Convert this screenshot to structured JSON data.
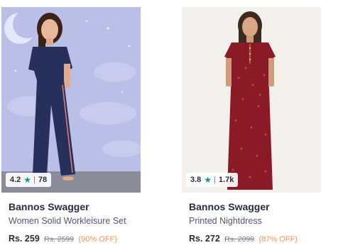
{
  "products": [
    {
      "brand": "Bannos Swagger",
      "name": "Women Solid Workleisure Set",
      "price": "Rs. 259",
      "mrp": "Rs. 2599",
      "discount": "(90% OFF)",
      "rating": "4.2",
      "rating_count": "78",
      "rating_sep": "|"
    },
    {
      "brand": "Bannos Swagger",
      "name": "Printed Nightdress",
      "price": "Rs. 272",
      "mrp": "Rs. 2099",
      "discount": "(87% OFF)",
      "rating": "3.8",
      "rating_count": "1.7k",
      "rating_sep": "|"
    }
  ],
  "colors": {
    "star": "#14958f",
    "discount": "#ff905a",
    "text_primary": "#282c3f",
    "text_secondary": "#535766"
  }
}
